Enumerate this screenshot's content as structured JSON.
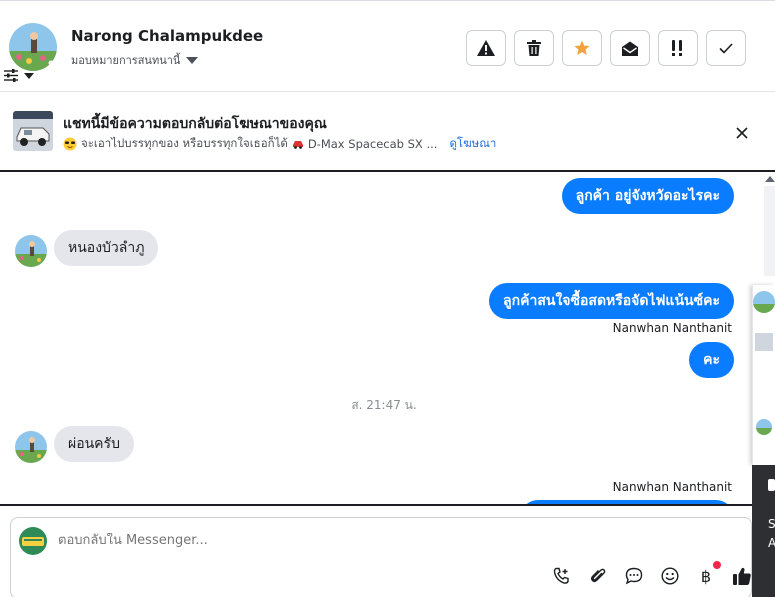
{
  "header": {
    "contact_name": "Narong Chalampukdee",
    "assign_label": "มอบหมายการสนทนานี้",
    "actions": [
      "spam",
      "delete",
      "star",
      "mark-unread",
      "follow-up",
      "done"
    ]
  },
  "ad_banner": {
    "title": "แชทนี้มีข้อความตอบกลับต่อโฆษณาของคุณ",
    "subtitle": "จะเอาไปบรรทุกของ หรือบรรทุกใจเธอก็ได้",
    "car_text": "D-Max Spacecab SX ...",
    "link": "ดูโฆษณา"
  },
  "messages": [
    {
      "dir": "out",
      "text": "ลูกค้า อยู่จังหวัดอะไรคะ"
    },
    {
      "dir": "in",
      "text": "หนองบัวลำภู"
    },
    {
      "dir": "out",
      "text": "ลูกค้าสนใจซื้อสดหรือจัดไฟแน้นซ์คะ"
    },
    {
      "sender": "Nanwhan Nanthanit"
    },
    {
      "dir": "out",
      "text": "คะ"
    },
    {
      "timestamp": "ส. 21:47 น."
    },
    {
      "dir": "in",
      "text": "ผ่อนครับ"
    },
    {
      "sender": "Nanwhan Nanthanit"
    }
  ],
  "side_panel": {
    "text_s": "S",
    "text_a": "A"
  },
  "composer": {
    "placeholder": "ตอบกลับใน Messenger...",
    "icons": [
      "call-icon",
      "attach-icon",
      "chat-bubble-icon",
      "emoji-icon",
      "baht-icon",
      "like-icon"
    ]
  }
}
